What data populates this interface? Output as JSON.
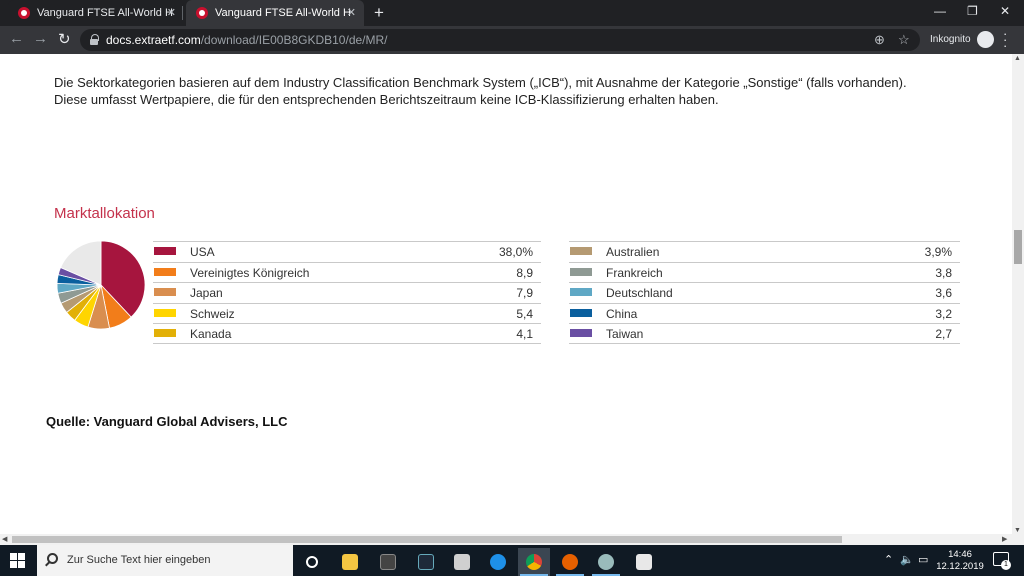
{
  "browser": {
    "tabs": [
      {
        "label": "Vanguard FTSE All-World High D...",
        "active": false
      },
      {
        "label": "Vanguard FTSE All-World High D...",
        "active": true
      }
    ],
    "url_host": "docs.extraetf.com",
    "url_path": "/download/IE00B8GKDB10/de/MR/",
    "incognito_label": "Inkognito"
  },
  "page": {
    "intro_line1": "Die Sektorkategorien basieren auf dem Industry Classification Benchmark System („ICB“), mit Ausnahme der Kategorie „Sonstige“ (falls vorhanden).",
    "intro_line2": "Diese umfasst Wertpapiere, die für den entsprechenden Berichtszeitraum keine ICB-Klassifizierung erhalten haben.",
    "section_title": "Marktallokation",
    "source": "Quelle: Vanguard Global Advisers, LLC"
  },
  "chart_data": {
    "type": "pie",
    "title": "Marktallokation",
    "labels": [
      "USA",
      "Vereinigtes Königreich",
      "Japan",
      "Schweiz",
      "Kanada",
      "Australien",
      "Frankreich",
      "Deutschland",
      "China",
      "Taiwan"
    ],
    "values": [
      38.0,
      8.9,
      7.9,
      5.4,
      4.1,
      3.9,
      3.8,
      3.6,
      3.2,
      2.7
    ],
    "display_values": [
      "38,0%",
      "8,9",
      "7,9",
      "5,4",
      "4,1",
      "3,9%",
      "3,8",
      "3,6",
      "3,2",
      "2,7"
    ],
    "colors": [
      "#a6153e",
      "#f27d1a",
      "#d98e4f",
      "#ffd500",
      "#e2b007",
      "#b59a72",
      "#8f9a94",
      "#5fa8c5",
      "#0a5f9e",
      "#6a4fa3"
    ],
    "remainder_color": "#e9e9e9",
    "legend_placement": "right"
  },
  "taskbar": {
    "search_placeholder": "Zur Suche Text hier eingeben",
    "time": "14:46",
    "date": "12.12.2019",
    "notification_count": "1"
  }
}
